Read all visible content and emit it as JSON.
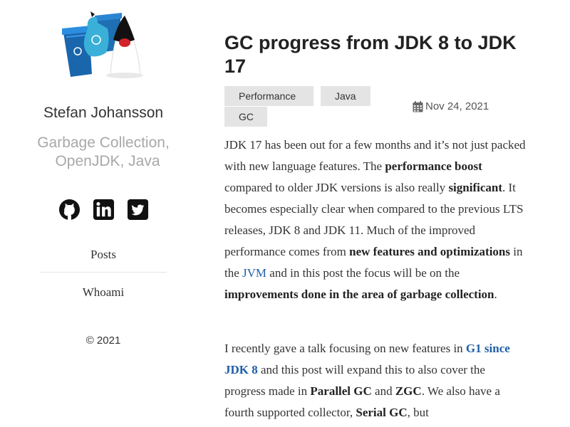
{
  "sidebar": {
    "author": "Stefan Johansson",
    "tagline_line1": "Garbage Collection,",
    "tagline_line2": "OpenJDK, Java",
    "social_icons": [
      "github-icon",
      "linkedin-icon",
      "twitter-icon"
    ],
    "nav": {
      "posts": "Posts",
      "whoami": "Whoami"
    },
    "copyright": "© 2021"
  },
  "post": {
    "title": "GC progress from JDK 8 to JDK 17",
    "tags": [
      "Performance",
      "Java",
      "GC"
    ],
    "date": "Nov 24, 2021",
    "p1": {
      "s1": "JDK 17 has been out for a few months and it’s not just packed with new language features. The ",
      "b1": "performance boost",
      "s2": " compared to older JDK versions is also really ",
      "b2": "significant",
      "s3": ". It becomes especially clear when compared to the previous LTS releases, JDK 8 and JDK 11. Much of the improved performance comes from ",
      "b3": "new features and optimizations",
      "s4": " in the ",
      "link": "JVM",
      "s5": " and in this post the focus will be on the ",
      "b4": "improvements done in the area of garbage collection",
      "s6": "."
    },
    "p2": {
      "s1": "I recently gave a talk focusing on new features in ",
      "link": "G1 since JDK 8",
      "s2": " and this post will expand this to also cover the progress made in ",
      "b1": "Parallel GC",
      "s3": " and ",
      "b2": "ZGC",
      "s4": ". We also have a fourth supported collector, ",
      "b3": "Serial GC",
      "s5": ", but"
    }
  },
  "colors": {
    "link": "#1f5fa8",
    "tag_bg": "#e4e4e4",
    "muted": "#a8a8a8"
  }
}
